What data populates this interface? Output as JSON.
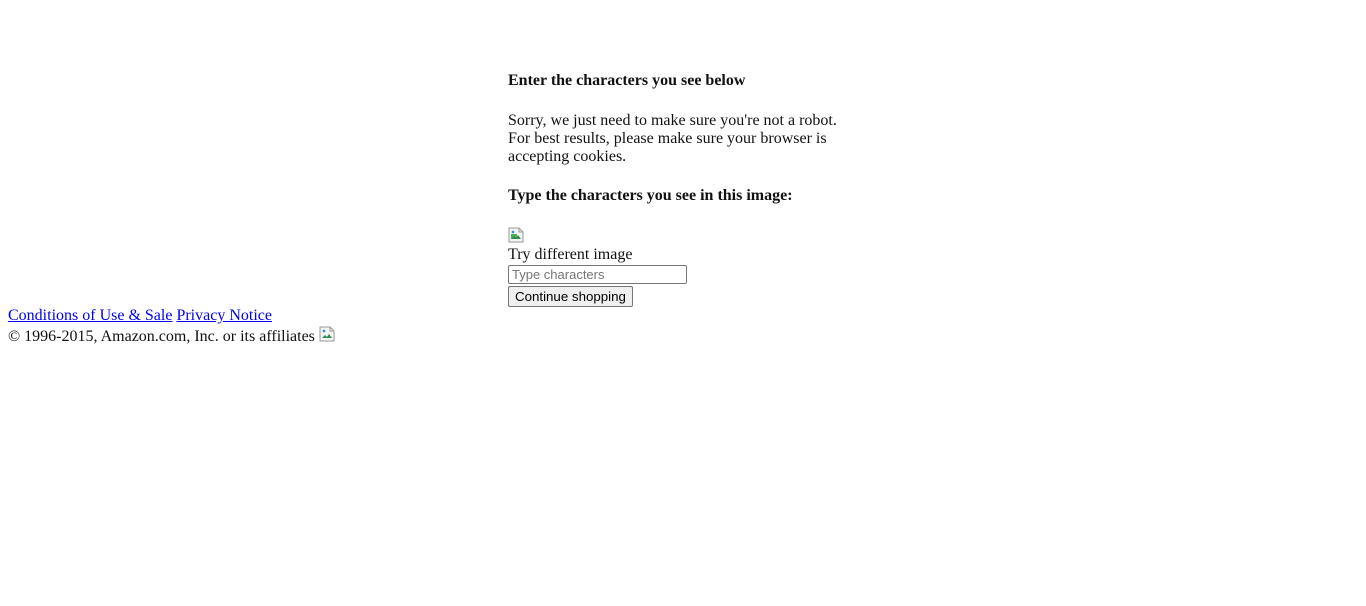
{
  "captcha_page": {
    "heading": "Enter the characters you see below",
    "explanation_line1": "Sorry, we just need to make sure you're not a robot.",
    "explanation_line2": "For best results, please make sure your browser is",
    "explanation_line3": "accepting cookies.",
    "subheading": "Type the characters you see in this image:",
    "try_different_image": "Try different image",
    "input_value": "",
    "input_placeholder": "Type characters",
    "continue_button": "Continue shopping"
  },
  "footer": {
    "conditions_link": "Conditions of Use & Sale",
    "privacy_link": "Privacy Notice",
    "copyright": "© 1996-2015, Amazon.com, Inc. or its affiliates"
  },
  "icons": {
    "captcha_image": "broken-image-icon",
    "footer_image": "broken-image-icon"
  }
}
